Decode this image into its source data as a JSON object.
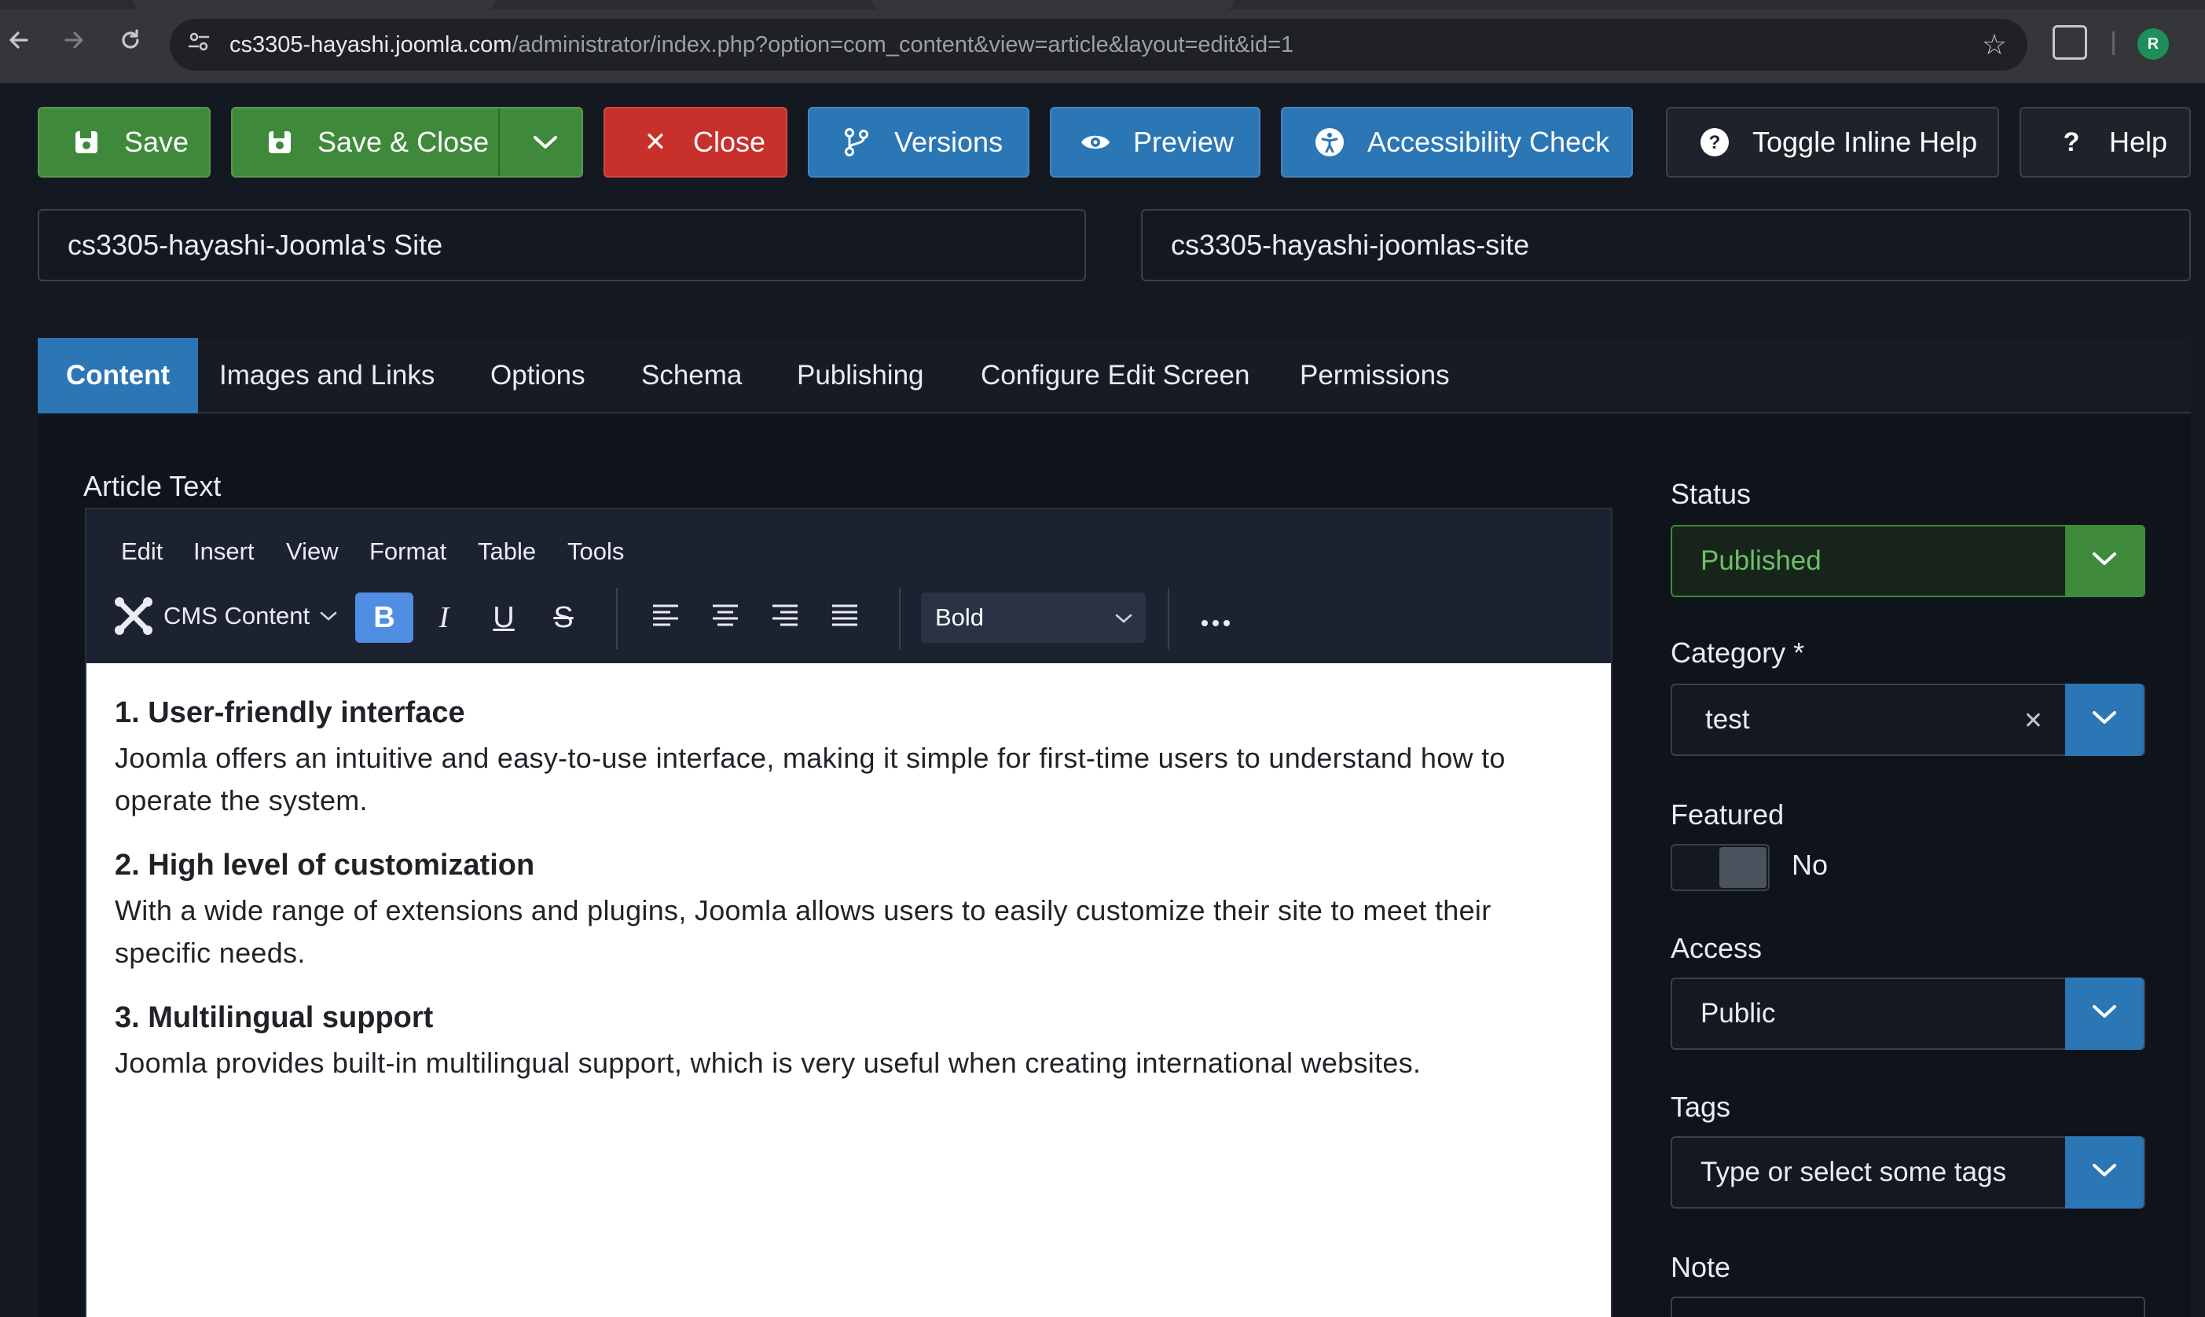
{
  "browser": {
    "url_host": "cs3305-hayashi.joomla.com",
    "url_path": "/administrator/index.php?option=com_content&view=article&layout=edit&id=1",
    "profile_initial": "R",
    "icons": [
      "back-arrow-icon",
      "forward-arrow-icon",
      "reload-icon",
      "site-settings-icon",
      "star-icon",
      "extensions-icon"
    ]
  },
  "toolbar": {
    "save": "Save",
    "save_close": "Save & Close",
    "close": "Close",
    "versions": "Versions",
    "preview": "Preview",
    "accessibility": "Accessibility Check",
    "inline_help": "Toggle Inline Help",
    "help": "Help"
  },
  "article": {
    "title": "cs3305-hayashi-Joomla's Site",
    "alias": "cs3305-hayashi-joomlas-site"
  },
  "tabs": [
    "Content",
    "Images and Links",
    "Options",
    "Schema",
    "Publishing",
    "Configure Edit Screen",
    "Permissions"
  ],
  "editor": {
    "label": "Article Text",
    "menu": [
      "Edit",
      "Insert",
      "View",
      "Format",
      "Table",
      "Tools"
    ],
    "cms_content": "CMS Content",
    "format_value": "Bold",
    "sections": [
      {
        "heading": "1. User-friendly interface",
        "body": "Joomla offers an intuitive and easy-to-use interface, making it simple for first-time users to understand how to operate the system."
      },
      {
        "heading": "2. High level of customization",
        "body": "With a wide range of extensions and plugins, Joomla allows users to easily customize their site to meet their specific needs."
      },
      {
        "heading": "3. Multilingual support",
        "body": "Joomla provides built-in multilingual support, which is very useful when creating international websites."
      }
    ]
  },
  "sidebar": {
    "status_label": "Status",
    "status_value": "Published",
    "category_label": "Category *",
    "category_value": "test",
    "featured_label": "Featured",
    "featured_value": "No",
    "access_label": "Access",
    "access_value": "Public",
    "tags_label": "Tags",
    "tags_placeholder": "Type or select some tags",
    "note_label": "Note"
  },
  "colors": {
    "green": "#3f8a3a",
    "red": "#c8302b",
    "blue": "#2b76b5",
    "background": "#141821",
    "active_format": "#4f8ee3"
  }
}
